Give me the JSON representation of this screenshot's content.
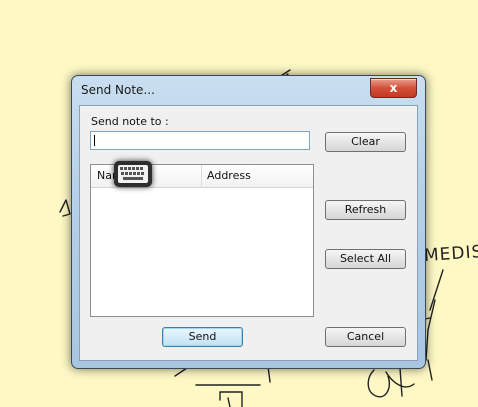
{
  "background": {
    "scrawl_text": "MEDIS"
  },
  "dialog": {
    "title": "Send Note...",
    "close_glyph": "x",
    "label": "Send note to :",
    "input_value": "",
    "buttons": {
      "clear": "Clear",
      "refresh": "Refresh",
      "select_all": "Select All",
      "send": "Send",
      "cancel": "Cancel"
    },
    "list": {
      "columns": [
        "Nam",
        "Address"
      ]
    }
  },
  "colors": {
    "desktop": "#fdf8c4",
    "close_button": "#c23a22"
  },
  "icons": {
    "overlay": "keyboard-icon"
  }
}
